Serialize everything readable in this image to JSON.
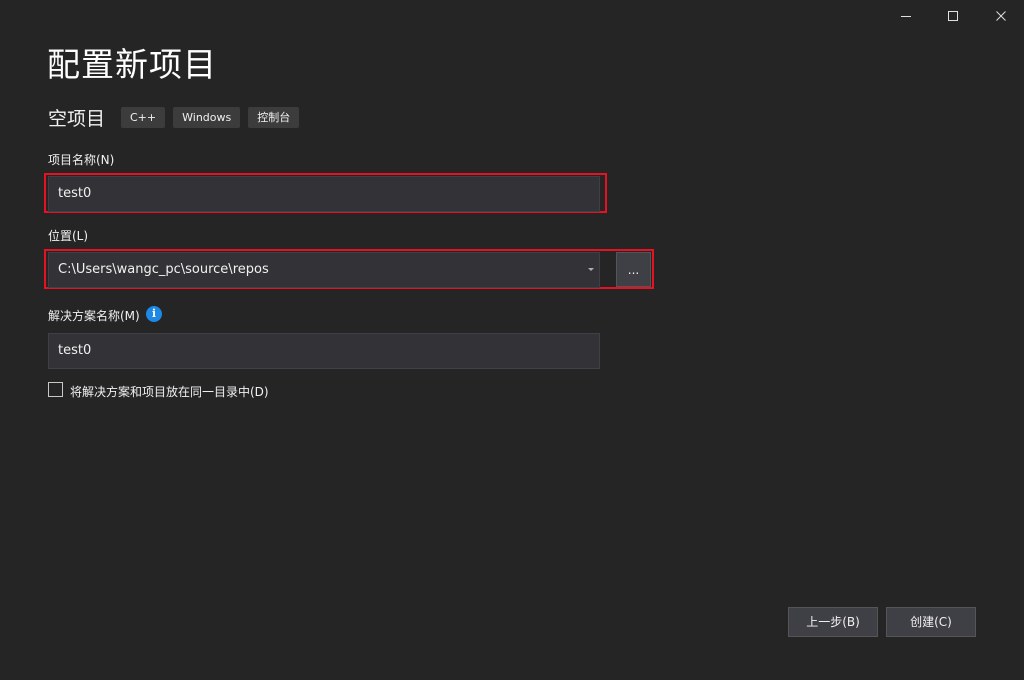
{
  "window": {
    "minimize_icon": "minimize-icon",
    "maximize_icon": "maximize-icon",
    "close_icon": "close-icon"
  },
  "title": "配置新项目",
  "template": {
    "name": "空项目",
    "tags": [
      "C++",
      "Windows",
      "控制台"
    ]
  },
  "project_name": {
    "label": "项目名称(N)",
    "value": "test0"
  },
  "location": {
    "label": "位置(L)",
    "value": "C:\\Users\\wangc_pc\\source\\repos",
    "browse_label": "..."
  },
  "solution_name": {
    "label": "解决方案名称(M)",
    "info_glyph": "i",
    "value": "test0"
  },
  "same_dir_checkbox": {
    "label": "将解决方案和项目放在同一目录中(D)",
    "checked": false
  },
  "buttons": {
    "back": "上一步(B)",
    "create": "创建(C)"
  },
  "colors": {
    "background": "#252526",
    "input_bg": "#333337",
    "highlight": "#e81123",
    "info_blue": "#1e88e5"
  }
}
